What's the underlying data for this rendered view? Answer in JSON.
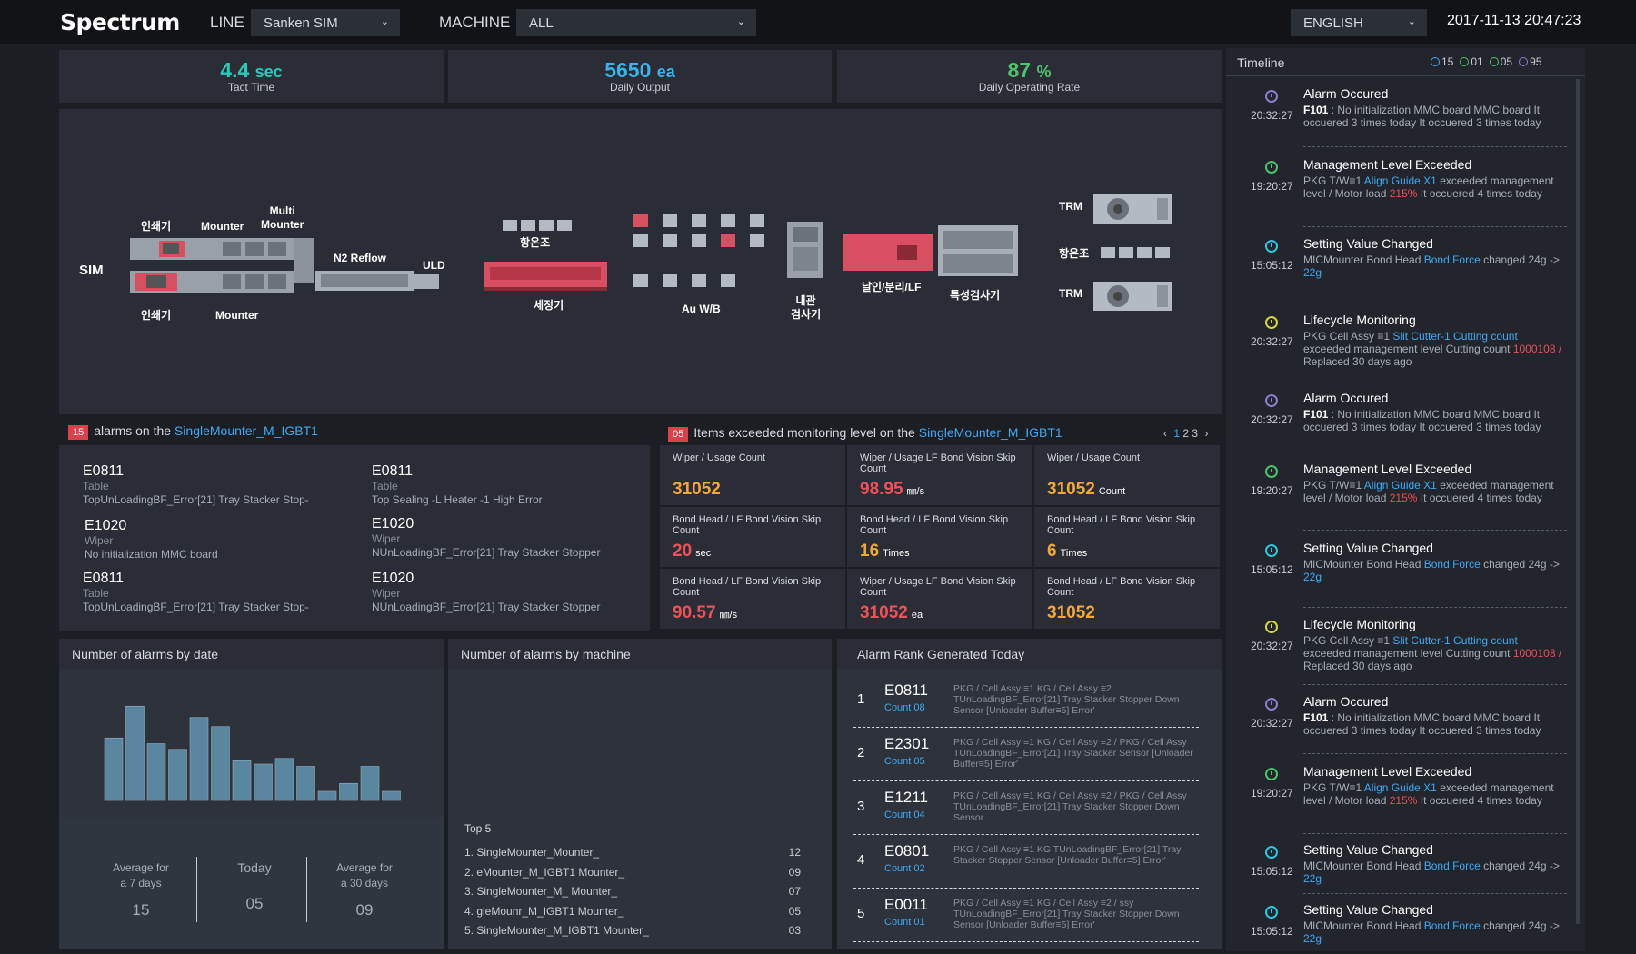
{
  "header": {
    "logo": "Spectrum",
    "line_label": "LINE",
    "line_value": "Sanken SIM",
    "machine_label": "MACHINE",
    "machine_value": "ALL",
    "language_value": "ENGLISH",
    "datetime": "2017-11-13 20:47:23"
  },
  "kpis": [
    {
      "value": "4.4",
      "unit": "sec",
      "label": "Tact Time",
      "color": "#2cc7b8"
    },
    {
      "value": "5650",
      "unit": "ea",
      "label": "Daily Output",
      "color": "#3ab4e8"
    },
    {
      "value": "87",
      "unit": "%",
      "label": "Daily Operating Rate",
      "color": "#4cc46c"
    }
  ],
  "line_map": {
    "labels": {
      "sim": "SIM",
      "printer_top": "인쇄기",
      "mounter_top": "Mounter",
      "multi_mounter": "Multi\nMounter",
      "printer_bottom": "인쇄기",
      "mounter_bottom": "Mounter",
      "n2_reflow": "N2 Reflow",
      "uld": "ULD",
      "oven1": "항온조",
      "washer": "세정기",
      "au_wb": "Au W/B",
      "inner_inspection": "내관\n검사기",
      "cut_form": "날인/분리/LF",
      "char_inspection": "특성검사기",
      "trm_top": "TRM",
      "oven2": "항온조",
      "trm_bottom": "TRM"
    }
  },
  "alarms_panel": {
    "count": "15",
    "title_prefix": "alarms on the",
    "machine_link": "SingleMounter_M_IGBT1",
    "items": [
      {
        "code": "E0811",
        "category": "Table",
        "desc": "TopUnLoadingBF_Error[21] Tray Stacker Stop-"
      },
      {
        "code": "E0811",
        "category": "Table",
        "desc": "Top Sealing -L Heater -1 High Error"
      },
      {
        "code": "E1020",
        "category": "Wiper",
        "desc": "No initialization MMC board"
      },
      {
        "code": "E1020",
        "category": "Wiper",
        "desc": "NUnLoadingBF_Error[21] Tray Stacker Stopper"
      },
      {
        "code": "E0811",
        "category": "Table",
        "desc": "TopUnLoadingBF_Error[21] Tray Stacker Stop-"
      },
      {
        "code": "E1020",
        "category": "Wiper",
        "desc": "NUnLoadingBF_Error[21] Tray Stacker Stopper"
      }
    ]
  },
  "monitor_panel": {
    "count": "05",
    "title_prefix": "Items exceeded monitoring level on the",
    "machine_link": "SingleMounter_M_IGBT1",
    "pager": {
      "prev": "‹",
      "pages": [
        "1",
        "2",
        "3"
      ],
      "next": "›"
    },
    "cells": [
      {
        "label": "Wiper / Usage Count",
        "value": "31052",
        "unit": "",
        "color": "orange"
      },
      {
        "label": "Wiper / Usage LF Bond Vision Skip Count",
        "value": "98.95",
        "unit": "㎜/s",
        "color": "red"
      },
      {
        "label": "Wiper / Usage Count",
        "value": "31052",
        "unit": "Count",
        "color": "orange"
      },
      {
        "label": "Bond Head / LF Bond Vision Skip Count",
        "value": "20",
        "unit": "sec",
        "color": "red"
      },
      {
        "label": "Bond Head / LF Bond Vision Skip Count",
        "value": "16",
        "unit": "Times",
        "color": "orange"
      },
      {
        "label": "Bond Head / LF Bond Vision Skip Count",
        "value": "6",
        "unit": "Times",
        "color": "orange"
      },
      {
        "label": "Bond Head / LF Bond Vision Skip Count",
        "value": "90.57",
        "unit": "㎜/s",
        "color": "red"
      },
      {
        "label": "Wiper / Usage LF Bond Vision Skip Count",
        "value": "31052",
        "unit": "ea",
        "color": "red"
      },
      {
        "label": "Bond Head / LF Bond Vision Skip Count",
        "value": "31052",
        "unit": "",
        "color": "orange"
      }
    ]
  },
  "alarms_by_date": {
    "title": "Number of alarms by date",
    "stats": [
      {
        "label": "Average for\na 7 days",
        "value": "15"
      },
      {
        "label": "Today",
        "value": "05"
      },
      {
        "label": "Average for\na 30 days",
        "value": "09"
      }
    ]
  },
  "chart_data": {
    "type": "bar",
    "title": "Number of alarms by date",
    "values": [
      55,
      83,
      50,
      45,
      73,
      65,
      35,
      32,
      37,
      30,
      8,
      15,
      30,
      8
    ],
    "ylim": [
      0,
      100
    ],
    "color": "#5b86a0"
  },
  "alarms_by_machine": {
    "title": "Number of alarms by machine",
    "top5_label": "Top 5",
    "top5": [
      {
        "name": "1. SingleMounter_Mounter_",
        "count": "12"
      },
      {
        "name": "2. eMounter_M_IGBT1 Mounter_",
        "count": "09"
      },
      {
        "name": "3. SingleMounter_M_ Mounter_",
        "count": "07"
      },
      {
        "name": "4. gleMounr_M_IGBT1 Mounter_",
        "count": "05"
      },
      {
        "name": "5. SingleMounter_M_IGBT1 Mounter_",
        "count": "03"
      }
    ]
  },
  "alarm_rank": {
    "title": "Alarm Rank Generated Today",
    "items": [
      {
        "rank": "1",
        "code": "E0811",
        "count": "Count 08",
        "desc": "PKG / Cell Assy ≡1 KG / Cell Assy ≡2 TUnLoadingBF_Error[21] Tray Stacker Stopper Down Sensor [Unloader Buffer≡5] Error'"
      },
      {
        "rank": "2",
        "code": "E2301",
        "count": "Count 05",
        "desc": "PKG / Cell Assy ≡1 KG / Cell Assy ≡2 / PKG / Cell Assy TUnLoadingBF_Error[21] Tray Stacker Sensor [Unloader Buffer≡5] Error'"
      },
      {
        "rank": "3",
        "code": "E1211",
        "count": "Count 04",
        "desc": "PKG / Cell Assy ≡1 KG / Cell Assy ≡2 / PKG / Cell Assy TUnLoadingBF_Error[21] Tray Stacker Stopper Down Sensor"
      },
      {
        "rank": "4",
        "code": "E0801",
        "count": "Count 02",
        "desc": "PKG / Cell Assy ≡1 KG TUnLoadingBF_Error[21] Tray Stacker Stopper Sensor [Unloader Buffer≡5] Error'"
      },
      {
        "rank": "5",
        "code": "E0011",
        "count": "Count 01",
        "desc": "PKG / Cell Assy ≡1 KG / Cell Assy ≡2 / ssy TUnLoadingBF_Error[21] Tray Stacker Stopper Down Sensor [Unloader Buffer≡5] Error'"
      }
    ]
  },
  "timeline": {
    "title": "Timeline",
    "counts": [
      {
        "value": "15",
        "color": "#3da9f5"
      },
      {
        "value": "01",
        "color": "#4cc46c"
      },
      {
        "value": "05",
        "color": "#4cc46c"
      },
      {
        "value": "95",
        "color": "#8a7fd0"
      }
    ],
    "items": [
      {
        "type": "Alarm Occured",
        "time": "20:32:27",
        "color": "#8a7fd0",
        "parts": [
          [
            "F101",
            "b"
          ],
          [
            " : No initialization MMC board  MMC board It occuered 3 times today It occuered 3 times today",
            ""
          ]
        ]
      },
      {
        "type": "Management Level Exceeded",
        "time": "19:20:27",
        "color": "#4cc46c",
        "parts": [
          [
            "PKG T/W≡1 ",
            ""
          ],
          [
            "Align Guide X1",
            "link"
          ],
          [
            " exceeded management level / Motor load ",
            ""
          ],
          [
            "215%",
            "red"
          ],
          [
            " It occuered 4 times today",
            ""
          ]
        ]
      },
      {
        "type": "Setting Value Changed",
        "time": "15:05:12",
        "color": "#2cc7e0",
        "parts": [
          [
            "MICMounter Bond Head ",
            ""
          ],
          [
            "Bond Force",
            "link"
          ],
          [
            " changed 24g -> ",
            ""
          ],
          [
            "22g",
            "link"
          ]
        ]
      },
      {
        "type": "Lifecycle Monitoring",
        "time": "20:32:27",
        "color": "#d6d63a",
        "parts": [
          [
            "PKG Cell Assy ≡1 ",
            ""
          ],
          [
            "Slit Cutter-1 Cutting count",
            "link"
          ],
          [
            " exceeded management level Cutting count ",
            ""
          ],
          [
            "1000108 /",
            "red"
          ],
          [
            " Replaced 30 days ago",
            ""
          ]
        ]
      },
      {
        "type": "Alarm Occured",
        "time": "20:32:27",
        "color": "#8a7fd0",
        "parts": [
          [
            "F101",
            "b"
          ],
          [
            " : No initialization MMC board  MMC board It occuered 3 times today It occuered 3 times today",
            ""
          ]
        ]
      },
      {
        "type": "Management Level Exceeded",
        "time": "19:20:27",
        "color": "#4cc46c",
        "parts": [
          [
            "PKG T/W≡1 ",
            ""
          ],
          [
            "Align Guide X1",
            "link"
          ],
          [
            " exceeded management level / Motor load ",
            ""
          ],
          [
            "215%",
            "red"
          ],
          [
            " It occuered 4 times today",
            ""
          ]
        ]
      },
      {
        "type": "Setting Value Changed",
        "time": "15:05:12",
        "color": "#2cc7e0",
        "parts": [
          [
            "MICMounter Bond Head ",
            ""
          ],
          [
            "Bond Force",
            "link"
          ],
          [
            " changed 24g -> ",
            ""
          ],
          [
            "22g",
            "link"
          ]
        ]
      },
      {
        "type": "Lifecycle Monitoring",
        "time": "20:32:27",
        "color": "#d6d63a",
        "parts": [
          [
            "PKG Cell Assy ≡1 ",
            ""
          ],
          [
            "Slit Cutter-1 Cutting count",
            "link"
          ],
          [
            " exceeded management level Cutting count ",
            ""
          ],
          [
            "1000108 /",
            "red"
          ],
          [
            " Replaced 30 days ago",
            ""
          ]
        ]
      },
      {
        "type": "Alarm Occured",
        "time": "20:32:27",
        "color": "#8a7fd0",
        "parts": [
          [
            "F101",
            "b"
          ],
          [
            " : No initialization MMC board  MMC board It occuered 3 times today It occuered 3 times today",
            ""
          ]
        ]
      },
      {
        "type": "Management Level Exceeded",
        "time": "19:20:27",
        "color": "#4cc46c",
        "parts": [
          [
            "PKG T/W≡1 ",
            ""
          ],
          [
            "Align Guide X1",
            "link"
          ],
          [
            " exceeded management level / Motor load ",
            ""
          ],
          [
            "215%",
            "red"
          ],
          [
            " It occuered 4 times today",
            ""
          ]
        ]
      },
      {
        "type": "Setting Value Changed",
        "time": "15:05:12",
        "color": "#2cc7e0",
        "parts": [
          [
            "MICMounter Bond Head ",
            ""
          ],
          [
            "Bond Force",
            "link"
          ],
          [
            " changed 24g -> ",
            ""
          ],
          [
            "22g",
            "link"
          ]
        ]
      },
      {
        "type": "Setting Value Changed",
        "time": "15:05:12",
        "color": "#2cc7e0",
        "parts": [
          [
            "MICMounter Bond Head ",
            ""
          ],
          [
            "Bond Force",
            "link"
          ],
          [
            " changed 24g -> ",
            ""
          ],
          [
            "22g",
            "link"
          ]
        ]
      }
    ]
  },
  "icons": {
    "dropdown": "chevron-down-icon",
    "timeline_item": "clock-icon",
    "pager_prev": "chevron-left-icon",
    "pager_next": "chevron-right-icon"
  }
}
